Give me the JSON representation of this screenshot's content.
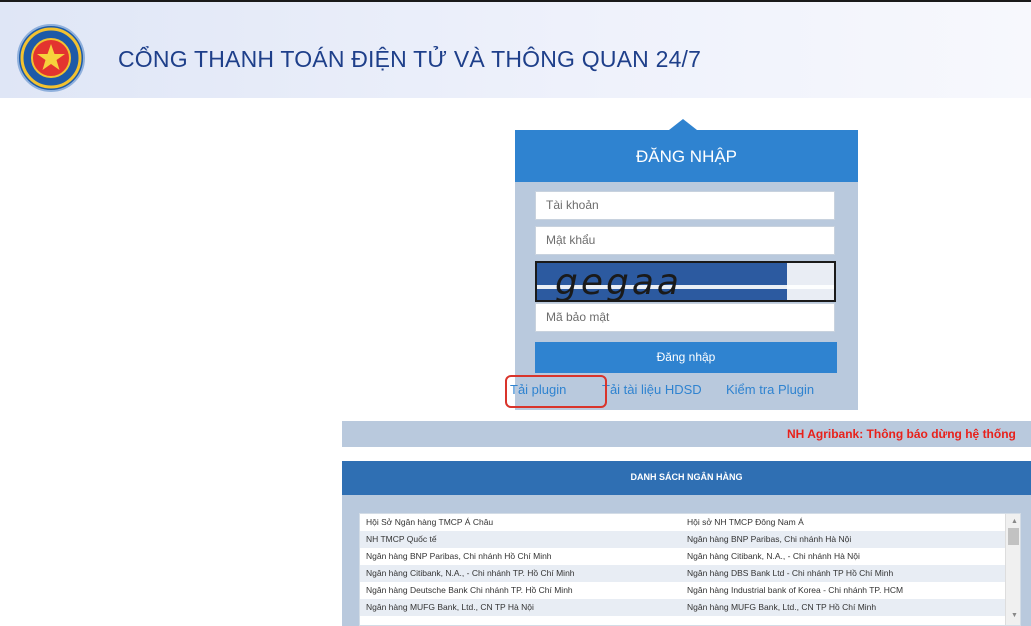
{
  "header": {
    "title": "CỔNG THANH TOÁN ĐIỆN TỬ VÀ THÔNG QUAN 24/7",
    "logo_icon": "customs-emblem-icon"
  },
  "login": {
    "title": "ĐĂNG NHẬP",
    "username_placeholder": "Tài khoản",
    "password_placeholder": "Mật khẩu",
    "captcha_text": "gegaa",
    "captcha_placeholder": "Mã bảo mật",
    "submit_label": "Đăng nhập",
    "links": {
      "download_plugin": "Tải plugin",
      "download_guide": "Tải tài liệu HDSD",
      "check_plugin": "Kiểm tra Plugin"
    }
  },
  "notice": {
    "text": "NH Agribank: Thông báo dừng hệ thống"
  },
  "banks": {
    "title": "DANH SÁCH NGÂN HÀNG",
    "rows": [
      [
        "Hội Sở Ngân hàng TMCP Á Châu",
        "Hội sở NH TMCP Đông Nam Á"
      ],
      [
        "NH TMCP Quốc tế",
        "Ngân hàng BNP Paribas, Chi nhánh Hà Nội"
      ],
      [
        "Ngân hàng BNP Paribas, Chi nhánh Hồ Chí Minh",
        "Ngân hàng Citibank, N.A., - Chi nhánh Hà Nội"
      ],
      [
        "Ngân hàng Citibank, N.A., - Chi nhánh TP. Hồ Chí Minh",
        "Ngân hàng DBS Bank Ltd - Chi nhánh TP Hồ Chí Minh"
      ],
      [
        "Ngân hàng Deutsche Bank Chi nhánh TP. Hồ Chí Minh",
        "Ngân hàng Industrial bank of Korea - Chi nhánh TP. HCM"
      ],
      [
        "Ngân hàng MUFG Bank, Ltd., CN TP Hà Nội",
        "Ngân hàng MUFG Bank, Ltd., CN TP Hồ Chí Minh"
      ]
    ]
  },
  "colors": {
    "primary_blue": "#2f83d0",
    "panel_gray_blue": "#b9c9dd",
    "notice_red": "#e8211b",
    "title_blue": "#1e3f8a",
    "highlight_circle": "#d9342b"
  }
}
